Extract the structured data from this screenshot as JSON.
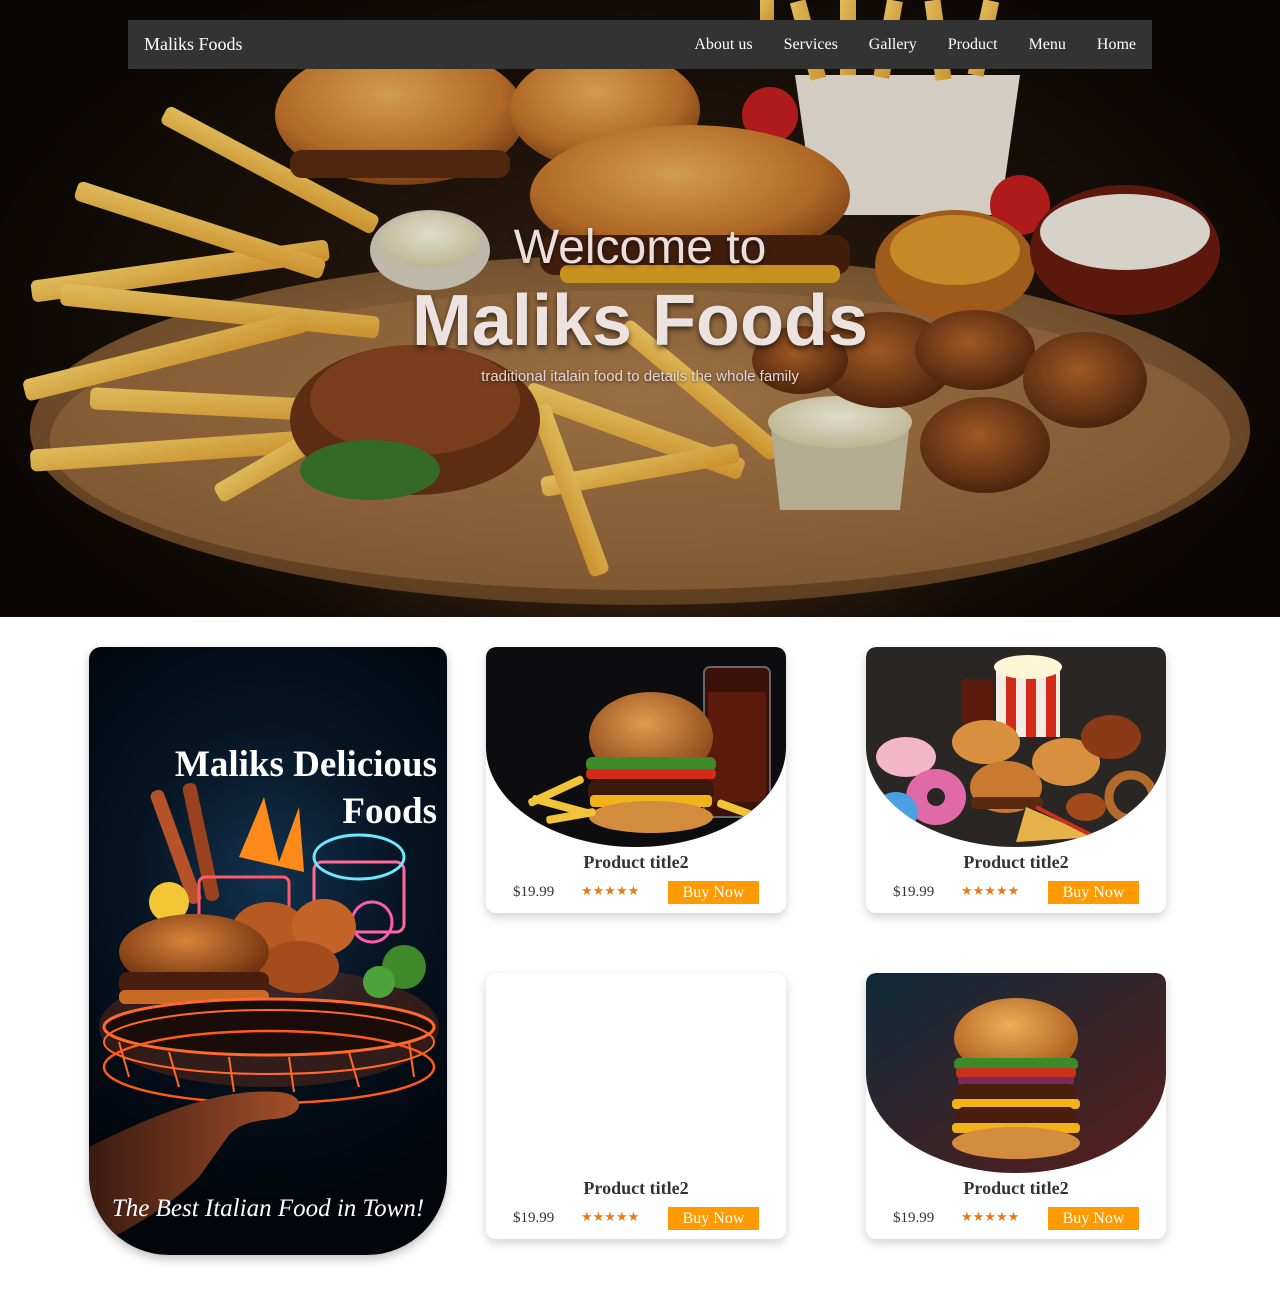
{
  "nav": {
    "brand": "Maliks Foods",
    "items": [
      {
        "label": "About us"
      },
      {
        "label": "Services"
      },
      {
        "label": "Gallery"
      },
      {
        "label": "Product"
      },
      {
        "label": "Menu"
      },
      {
        "label": "Home"
      }
    ]
  },
  "hero": {
    "welcome": "Welcome to",
    "title": "Maliks Foods",
    "tagline": "traditional italain food to details the whole family"
  },
  "promo": {
    "title_line1": "Maliks Delicious",
    "title_line2": "Foods",
    "footer": "The Best Italian Food in Town!"
  },
  "products": [
    {
      "title": "Product title2",
      "price": "$19.99",
      "rating": "★★★★★",
      "button": "Buy Now",
      "image": "burger-with-cola"
    },
    {
      "title": "Product title2",
      "price": "$19.99",
      "rating": "★★★★★",
      "button": "Buy Now",
      "image": "fast-food-spread"
    },
    {
      "title": "Product title2",
      "price": "$19.99",
      "rating": "★★★★★",
      "button": "Buy Now",
      "image": "empty"
    },
    {
      "title": "Product title2",
      "price": "$19.99",
      "rating": "★★★★★",
      "button": "Buy Now",
      "image": "double-cheeseburger"
    }
  ]
}
